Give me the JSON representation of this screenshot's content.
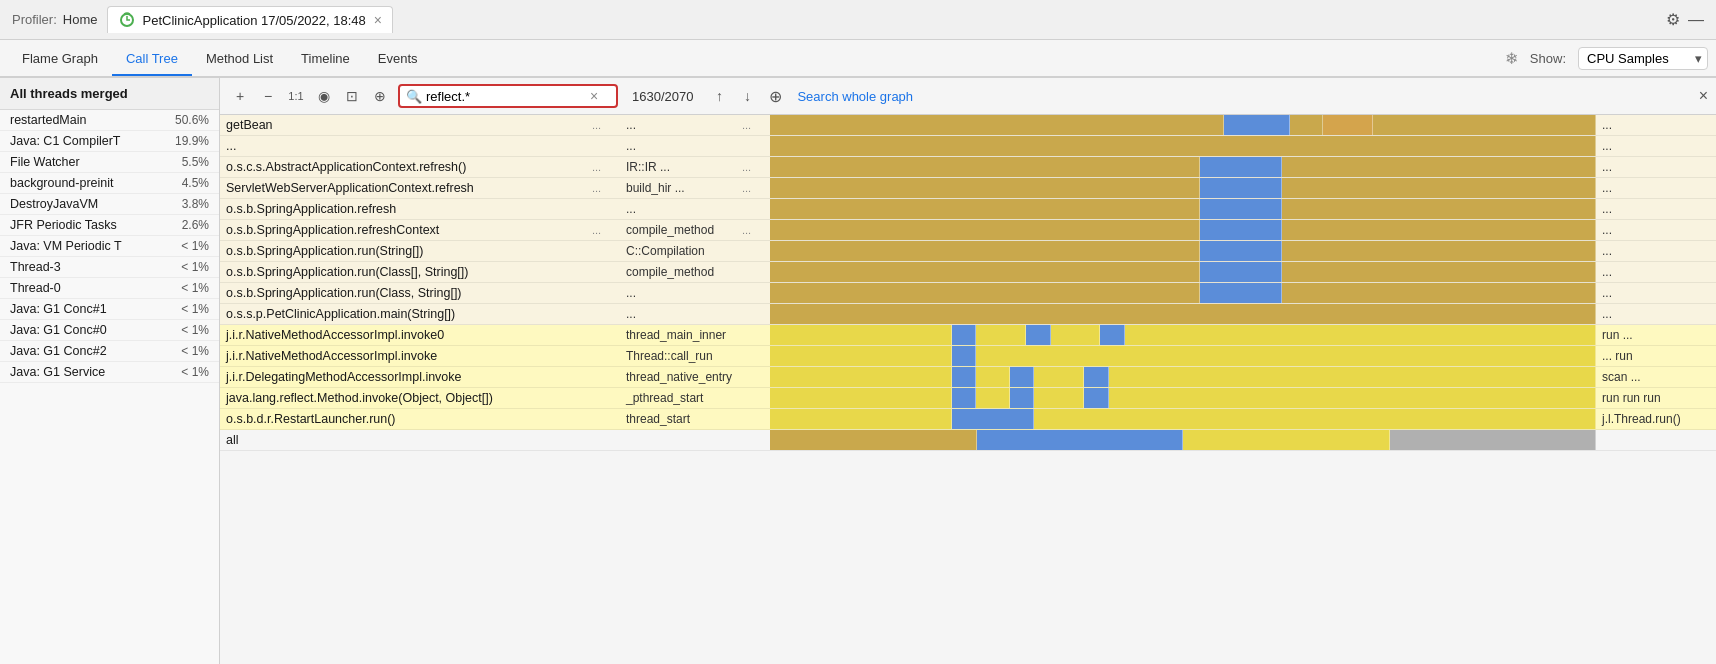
{
  "topbar": {
    "profiler_label": "Profiler:",
    "home_label": "Home",
    "app_tab": "PetClinicApplication 17/05/2022, 18:48",
    "settings_icon": "⚙",
    "minimize_icon": "—"
  },
  "navtabs": {
    "tabs": [
      {
        "label": "Flame Graph",
        "active": false
      },
      {
        "label": "Call Tree",
        "active": true
      },
      {
        "label": "Method List",
        "active": false
      },
      {
        "label": "Timeline",
        "active": false
      },
      {
        "label": "Events",
        "active": false
      }
    ],
    "show_label": "Show:",
    "show_value": "CPU Samples"
  },
  "sidebar": {
    "header": "All threads merged",
    "items": [
      {
        "name": "restartedMain",
        "pct": "50.6%"
      },
      {
        "name": "Java: C1 CompilerT",
        "pct": "19.9%"
      },
      {
        "name": "File Watcher",
        "pct": "5.5%"
      },
      {
        "name": "background-preinit",
        "pct": "4.5%"
      },
      {
        "name": "DestroyJavaVM",
        "pct": "3.8%"
      },
      {
        "name": "JFR Periodic Tasks",
        "pct": "2.6%"
      },
      {
        "name": "Java: VM Periodic T",
        "pct": "< 1%"
      },
      {
        "name": "Thread-3",
        "pct": "< 1%"
      },
      {
        "name": "Thread-0",
        "pct": "< 1%"
      },
      {
        "name": "Java: G1 Conc#1",
        "pct": "< 1%"
      },
      {
        "name": "Java: G1 Conc#0",
        "pct": "< 1%"
      },
      {
        "name": "Java: G1 Conc#2",
        "pct": "< 1%"
      },
      {
        "name": "Java: G1 Service",
        "pct": "< 1%"
      }
    ]
  },
  "search": {
    "query": "reflect.*",
    "count": "1630/2070",
    "placeholder": "Search",
    "whole_graph_label": "Search whole graph"
  },
  "controls": {
    "plus_icon": "+",
    "minus_icon": "−",
    "one_to_one_label": "1:1",
    "eye_icon": "👁",
    "camera_icon": "📷",
    "magnify_icon": "🔍",
    "up_arrow": "↑",
    "down_arrow": "↓",
    "target_icon": "⊕",
    "close_icon": "×",
    "freeze_icon": "❄"
  },
  "rows": [
    {
      "name": "getBean",
      "dots": "...",
      "extra": "...",
      "color": "gold",
      "highlighted": false
    },
    {
      "name": "...",
      "dots": "",
      "extra": "...",
      "color": "gold",
      "highlighted": false
    },
    {
      "name": "o.s.c.s.AbstractApplicationContext.refresh()",
      "dots": "...",
      "extra": "IR::IR ...",
      "color": "gold",
      "highlighted": false
    },
    {
      "name": "ServletWebServerApplicationContext.refresh",
      "dots": "...",
      "extra": "build_hir ...",
      "color": "gold",
      "highlighted": false
    },
    {
      "name": "o.s.b.SpringApplication.refresh",
      "dots": "",
      "extra": "...",
      "color": "gold",
      "highlighted": false
    },
    {
      "name": "o.s.b.SpringApplication.refreshContext",
      "dots": "...",
      "extra": "compile_method",
      "color": "gold",
      "highlighted": false
    },
    {
      "name": "o.s.b.SpringApplication.run(String[])",
      "dots": "",
      "extra": "C::Compilation",
      "color": "gold",
      "highlighted": false
    },
    {
      "name": "o.s.b.SpringApplication.run(Class[], String[])",
      "dots": "",
      "extra": "compile_method",
      "color": "gold",
      "highlighted": false
    },
    {
      "name": "o.s.b.SpringApplication.run(Class, String[])",
      "dots": "",
      "extra": "...",
      "color": "gold",
      "highlighted": false
    },
    {
      "name": "o.s.s.p.PetClinicApplication.main(String[])",
      "dots": "",
      "extra": "...",
      "color": "gold",
      "highlighted": false
    },
    {
      "name": "j.i.r.NativeMethodAccessorImpl.invoke0",
      "dots": "",
      "extra": "thread_main_inner",
      "color": "yellow",
      "highlighted": true
    },
    {
      "name": "j.i.r.NativeMethodAccessorImpl.invoke",
      "dots": "",
      "extra": "Thread::call_run",
      "color": "yellow",
      "highlighted": true
    },
    {
      "name": "j.i.r.DelegatingMethodAccessorImpl.invoke",
      "dots": "",
      "extra": "thread_native_entry",
      "color": "yellow",
      "highlighted": true
    },
    {
      "name": "java.lang.reflect.Method.invoke(Object, Object[])",
      "dots": "",
      "extra": "_pthread_start",
      "color": "yellow",
      "highlighted": true
    },
    {
      "name": "o.s.b.d.r.RestartLauncher.run()",
      "dots": "",
      "extra": "thread_start",
      "color": "yellow",
      "highlighted": true
    },
    {
      "name": "all",
      "dots": "",
      "extra": "",
      "color": "gray",
      "highlighted": false
    }
  ]
}
